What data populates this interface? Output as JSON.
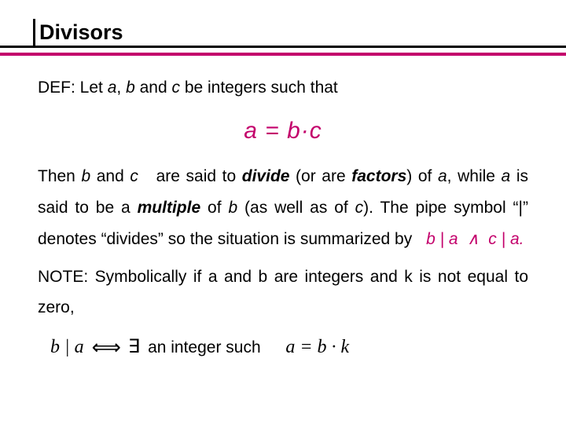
{
  "title": "Divisors",
  "vars": {
    "a": "a",
    "b": "b",
    "c": "c"
  },
  "punct": {
    "comma_sp": ", ",
    "comma": ",",
    "dot": "."
  },
  "def": {
    "prefix": "DEF:  ",
    "let": "Let ",
    "and": " and ",
    "tail": " be integers such that"
  },
  "formula": "a = b·c",
  "para": {
    "then": "Then ",
    "and": " and ",
    "said_to": " are said to ",
    "divide": "divide",
    "or_are": " (or are ",
    "factors": "factors",
    "paren_of": ") of ",
    "while": " while ",
    "is_said": " is said to be a ",
    "multiple": "multiple",
    "of": " of ",
    "as_well": " (as well as of ",
    "paren_dot": ").  ",
    "pipe_sentence": "The pipe symbol “|” denotes “divides” so the situation is summarized by "
  },
  "expr": {
    "pipe": " | ",
    "wedge": "∧"
  },
  "note": "NOTE: Symbolically if a and b are integers and k is not equal to zero,",
  "sym": {
    "lhs": "b | a",
    "iff": "⟺",
    "exists": "∃",
    "mid": " an integer such",
    "rhs": "a = b · k"
  }
}
